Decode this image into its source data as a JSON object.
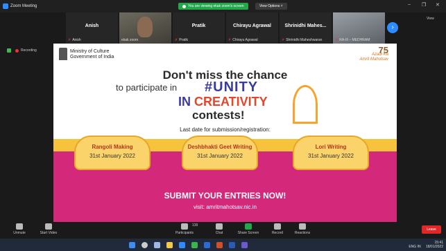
{
  "window": {
    "title": "Zoom Meeting",
    "share_banner": "You are viewing ekak zoom's screen",
    "view_options": "View Options ˅",
    "view": "View",
    "min": "–",
    "restore": "❐",
    "close": "✕"
  },
  "participants": [
    {
      "big": "Anish",
      "small": "Anish"
    },
    {
      "big": "",
      "small": "ekak zoom"
    },
    {
      "big": "Pratik",
      "small": "Pratik"
    },
    {
      "big": "Chirayu Agrawal",
      "small": "Chirayu Agrawal"
    },
    {
      "big": "Shrinidhi Mahes...",
      "small": "Shrinidhi Maheshwaran"
    },
    {
      "big": "",
      "small": "RA-III – MEDHRAM"
    }
  ],
  "recording": "Recording",
  "poster": {
    "ministry_line1": "Ministry of Culture",
    "ministry_line2": "Government of India",
    "azadi_num": "75",
    "azadi_line1": "Azadi Ka",
    "azadi_line2": "Amrit Mahotsav",
    "headline": "Don't miss the chance",
    "participate": "to participate in",
    "unity": "#UNITY",
    "in": "IN",
    "creativity": "CREATIVITY",
    "contests": "contests!",
    "last_date": "Last date for submission/registration:",
    "cards": [
      {
        "title": "Rangoli Making",
        "date": "31st January 2022"
      },
      {
        "title": "Deshbhakti Geet Writing",
        "date": "31st January 2022"
      },
      {
        "title": "Lori Writing",
        "date": "31st January 2022"
      }
    ],
    "submit": "SUBMIT YOUR ENTRIES NOW!",
    "visit": "visit: amritmahotsav.nic.in"
  },
  "toolbar": {
    "unmute": "Unmute",
    "start_video": "Start Video",
    "participants": "Participants",
    "participant_count": "139",
    "chat": "Chat",
    "share_screen": "Share Screen",
    "record": "Record",
    "reactions": "Reactions",
    "leave": "Leave"
  },
  "taskbar": {
    "lang": "ENG IN",
    "time": "15:41",
    "date": "18/01/2022"
  },
  "colors": {
    "zoom_blue": "#2d8cff",
    "share_green": "#22a84a",
    "leave_red": "#e02828",
    "poster_pink": "#d4287a",
    "poster_yellow": "#f7c33d"
  }
}
